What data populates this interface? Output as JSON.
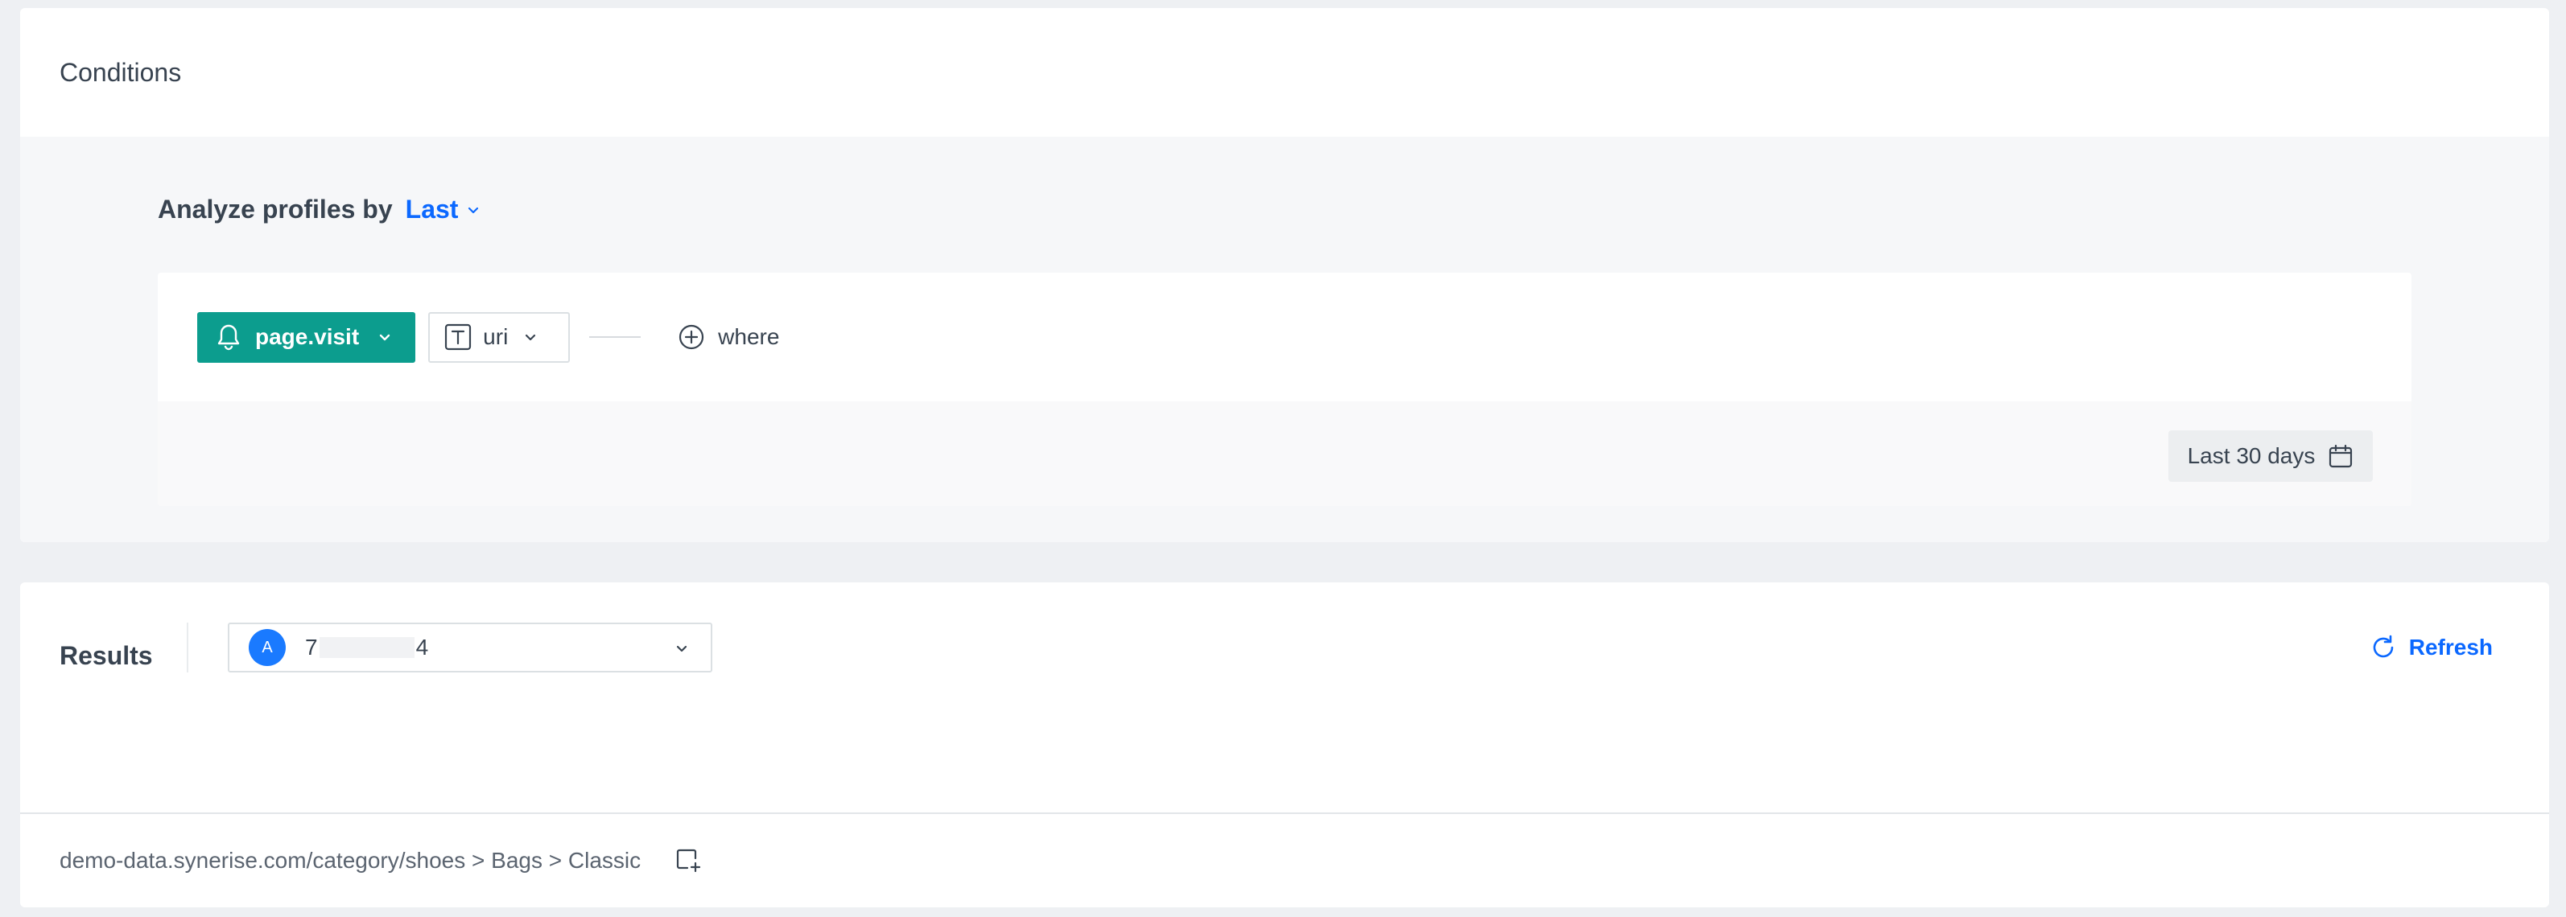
{
  "conditions": {
    "title": "Conditions",
    "analyze_label": "Analyze profiles by",
    "analyze_value": "Last",
    "event": {
      "label": "page.visit",
      "icon": "bell-icon",
      "color": "#0c9d8e"
    },
    "parameter": {
      "label": "uri",
      "icon": "text-type-icon"
    },
    "where_label": "where",
    "date_range": "Last 30 days"
  },
  "results": {
    "title": "Results",
    "profile": {
      "avatar_letter": "A",
      "id_prefix": "7",
      "id_suffix": "4"
    },
    "refresh_label": "Refresh",
    "row_value": "demo-data.synerise.com/category/shoes > Bags > Classic"
  },
  "colors": {
    "accent": "#0b68ff",
    "event_bg": "#0c9d8e",
    "avatar": "#1a7aff"
  }
}
